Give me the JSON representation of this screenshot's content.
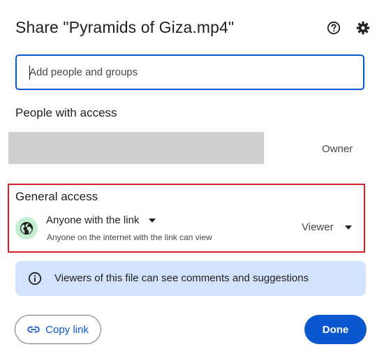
{
  "dialog": {
    "title": "Share \"Pyramids of Giza.mp4\"",
    "icons": {
      "help": "help-circle-icon",
      "settings": "gear-icon"
    }
  },
  "add_people": {
    "placeholder": "Add people and groups",
    "value": ""
  },
  "people_with_access": {
    "heading": "People with access",
    "entries": [
      {
        "name_redacted": true,
        "role": "Owner"
      }
    ]
  },
  "general_access": {
    "heading": "General access",
    "icon": "globe-icon",
    "link_option": "Anyone with the link",
    "description": "Anyone on the internet with the link can view",
    "role": "Viewer"
  },
  "info_banner": {
    "icon": "info-icon",
    "text": "Viewers of this file can see comments and suggestions"
  },
  "footer": {
    "copy_link_icon": "link-icon",
    "copy_link_label": "Copy link",
    "done_label": "Done"
  },
  "colors": {
    "accent": "#0b57d0",
    "highlight_border": "#d32029",
    "banner_bg": "#d3e3fd",
    "globe_bg": "#c4eed0"
  }
}
